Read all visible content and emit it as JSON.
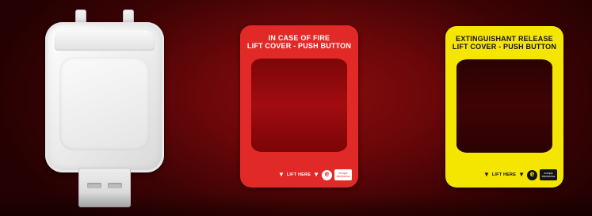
{
  "labels": {
    "fire": {
      "line1": "IN CASE OF FIRE",
      "line2": "LIFT COVER - PUSH BUTTON",
      "lift_here": "LIFT HERE",
      "brand_line1": "europa",
      "brand_line2": "electronics",
      "color": "#e12a27"
    },
    "extinguishant": {
      "line1": "EXTINGUISHANT RELEASE",
      "line2": "LIFT COVER - PUSH BUTTON",
      "lift_here": "LIFT HERE",
      "brand_line1": "europa",
      "brand_line2": "electronics",
      "color": "#f4e600"
    }
  },
  "icons": {
    "triangle": "▼",
    "e_logo": "e"
  },
  "colors": {
    "background": "#6a0709",
    "cover": "#eeeeee"
  }
}
